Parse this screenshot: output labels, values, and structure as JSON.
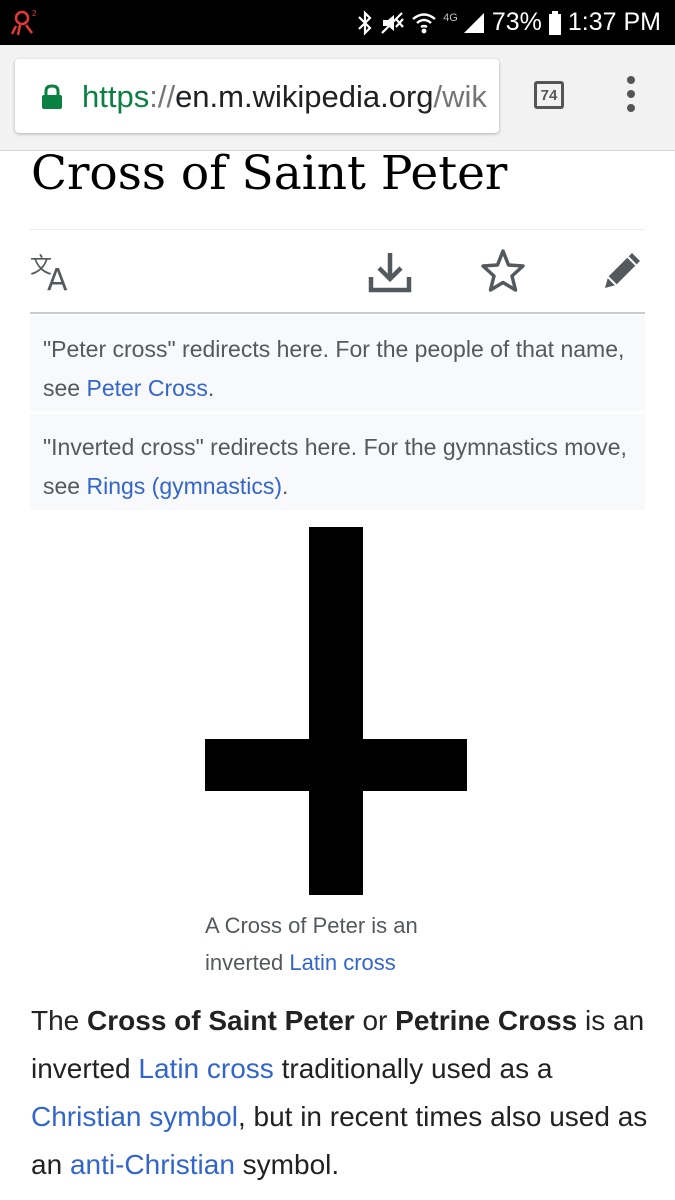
{
  "status_bar": {
    "network": "4G",
    "battery": "73%",
    "time": "1:37 PM"
  },
  "browser": {
    "url_scheme": "https",
    "url_sep": "://",
    "url_host": "en.m.wikipedia.org",
    "url_path": "/wik",
    "tab_count": "74"
  },
  "page": {
    "title": "Cross of Saint Peter",
    "actions": [
      "language-icon",
      "download-icon",
      "star-icon",
      "edit-icon"
    ],
    "hatnotes": [
      {
        "text": "\"Peter cross\" redirects here. For the people of that name, see ",
        "link": "Peter Cross",
        "after": "."
      },
      {
        "text": "\"Inverted cross\" redirects here. For the gymnastics move, see ",
        "link": "Rings (gymnastics)",
        "after": "."
      }
    ],
    "figure": {
      "caption_text": "A Cross of Peter is an inverted ",
      "caption_link": "Latin cross"
    },
    "lead": {
      "t1": "The ",
      "b1": "Cross of Saint Peter",
      "t2": " or ",
      "b2": "Petrine Cross",
      "t3": " is an inverted ",
      "l1": "Latin cross",
      "t4": " traditionally used as a ",
      "l2": "Christian symbol",
      "t5": ", but in recent times also used as an ",
      "l3": "anti-Christian",
      "t6": " symbol."
    }
  },
  "colors": {
    "link": "#3366cc",
    "url_secure": "#0b8043",
    "hatnote_bg": "#f8f9fa"
  }
}
